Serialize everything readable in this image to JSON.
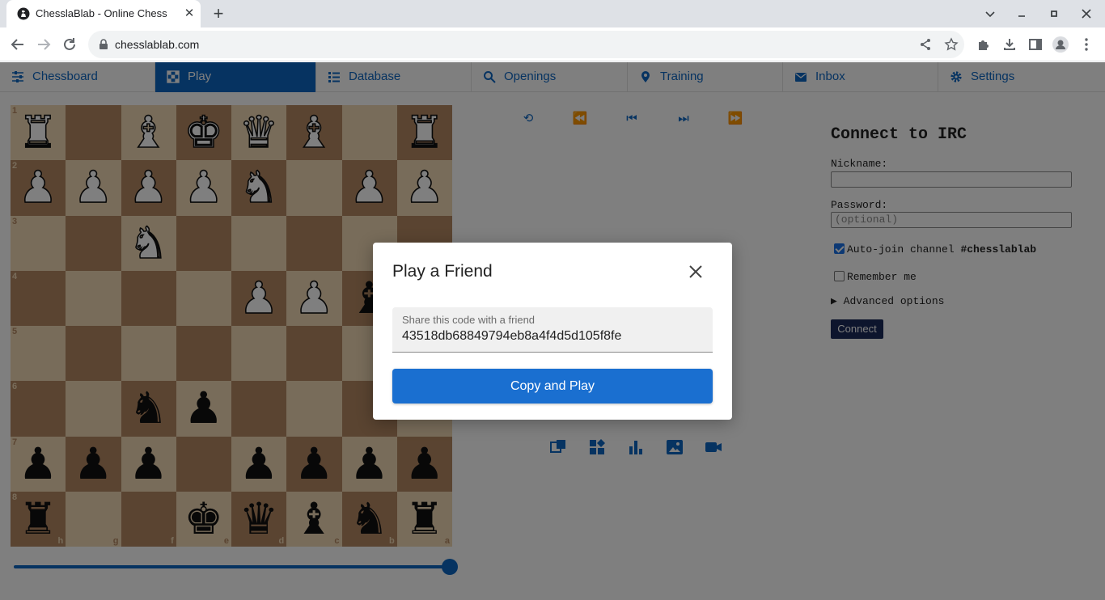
{
  "browser": {
    "tab_title": "ChesslaBlab - Online Chess",
    "url": "chesslablab.com"
  },
  "nav": {
    "items": [
      {
        "label": "Chessboard",
        "icon": "sliders-icon",
        "active": false
      },
      {
        "label": "Play",
        "icon": "chessboard-icon",
        "active": true
      },
      {
        "label": "Database",
        "icon": "list-icon",
        "active": false
      },
      {
        "label": "Openings",
        "icon": "search-icon",
        "active": false
      },
      {
        "label": "Training",
        "icon": "map-pin-icon",
        "active": false
      },
      {
        "label": "Inbox",
        "icon": "envelope-icon",
        "active": false
      },
      {
        "label": "Settings",
        "icon": "gear-icon",
        "active": false
      }
    ]
  },
  "board": {
    "orientation": "black-bottom",
    "ranks": [
      "1",
      "2",
      "3",
      "4",
      "5",
      "6",
      "7",
      "8"
    ],
    "files": [
      "h",
      "g",
      "f",
      "e",
      "d",
      "c",
      "b",
      "a"
    ],
    "rows": [
      [
        "wR",
        "",
        "wB",
        "wK",
        "wQ",
        "wB",
        "",
        "wR"
      ],
      [
        "wP",
        "wP",
        "wP",
        "wP",
        "wN",
        "",
        "wP",
        "wP"
      ],
      [
        "",
        "",
        "wN",
        "",
        "",
        "",
        "",
        ""
      ],
      [
        "",
        "",
        "",
        "",
        "wP",
        "wP",
        "bB",
        ""
      ],
      [
        "",
        "",
        "",
        "",
        "",
        "",
        "",
        ""
      ],
      [
        "",
        "",
        "bN",
        "bP",
        "",
        "",
        "",
        ""
      ],
      [
        "bP",
        "bP",
        "bP",
        "",
        "bP",
        "bP",
        "bP",
        "bP"
      ],
      [
        "bR",
        "",
        "",
        "bK",
        "bQ",
        "bB",
        "bN",
        "bR"
      ]
    ]
  },
  "move_slider": {
    "value_fraction": 1.0
  },
  "irc": {
    "title": "Connect to IRC",
    "nickname_label": "Nickname:",
    "nickname_value": "",
    "password_label": "Password:",
    "password_placeholder": "(optional)",
    "autojoin_label": "Auto-join channel ",
    "autojoin_channel": "#chesslablab",
    "autojoin_checked": true,
    "remember_label": "Remember me",
    "remember_checked": false,
    "advanced_label": "Advanced options",
    "connect_label": "Connect"
  },
  "modal": {
    "title": "Play a Friend",
    "field_label": "Share this code with a friend",
    "code": "43518db68849794eb8a4f4d5d105f8fe",
    "button_label": "Copy and Play"
  },
  "colors": {
    "primary": "#1a6fd0",
    "light_square": "#f0d9b5",
    "dark_square": "#b58863",
    "overlay": "rgba(0,0,0,0.5)"
  }
}
